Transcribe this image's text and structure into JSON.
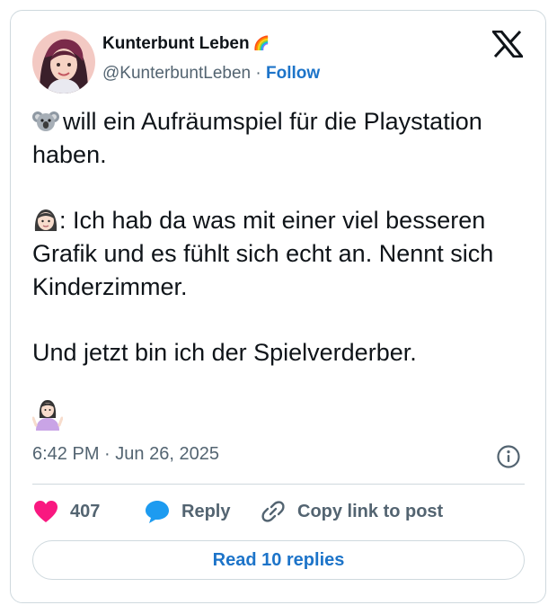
{
  "user": {
    "display_name": "Kunterbunt Leben",
    "badge": "🌈",
    "handle": "@KunterbuntLeben",
    "separator": "·",
    "follow_label": "Follow"
  },
  "tweet": {
    "line1_emoji": "koala-icon",
    "line1_text": "will ein Aufräumspiel für die Playstation haben.",
    "line2_emoji": "woman-face-icon",
    "line2_text": ": Ich hab da was mit einer viel besseren Grafik und es fühlt sich echt an. Nennt sich Kinderzimmer.",
    "line3_text": "Und jetzt bin ich der Spielverderber.",
    "line4_emoji": "woman-shrugging-icon"
  },
  "meta": {
    "time": "6:42 PM",
    "separator": "·",
    "date": "Jun 26, 2025"
  },
  "actions": {
    "likes_count": "407",
    "reply_label": "Reply",
    "copy_label": "Copy link to post",
    "read_replies_label": "Read 10 replies"
  },
  "colors": {
    "heart": "#f91880",
    "reply_bubble": "#1d9bf0",
    "link_blue": "#1d74c9",
    "secondary_text": "#536471",
    "border": "#cfd9de"
  }
}
